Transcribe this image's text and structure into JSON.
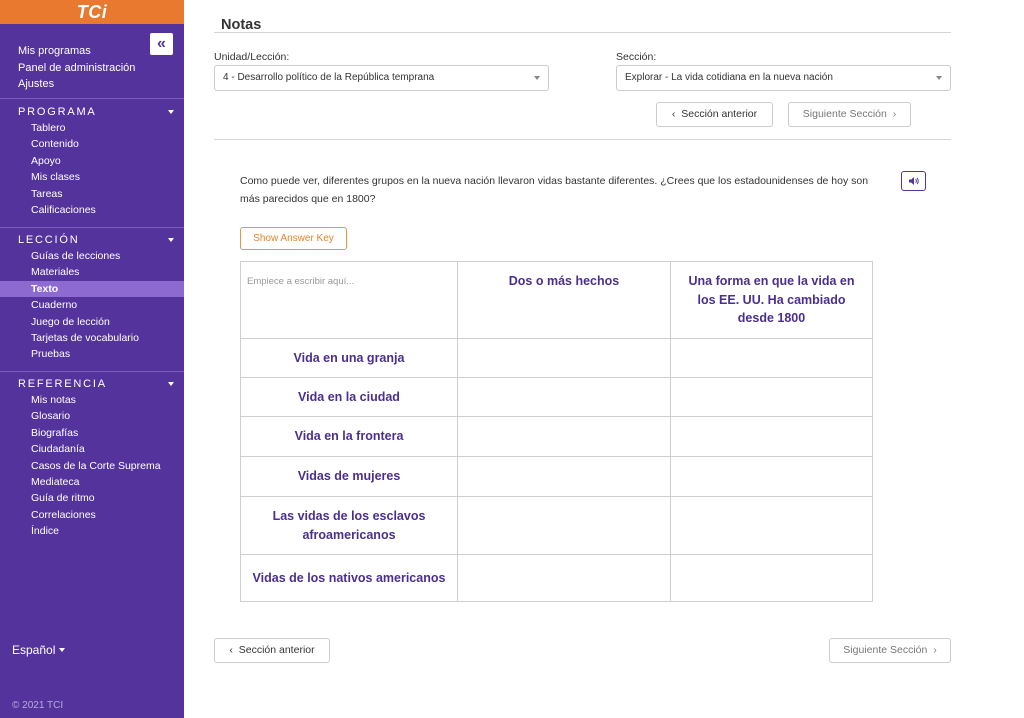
{
  "sidebar": {
    "logo": "TCi",
    "top_links": [
      "Mis programas",
      "Panel de administración",
      "Ajustes"
    ],
    "programa": {
      "title": "PROGRAMA",
      "items": [
        "Tablero",
        "Contenido",
        "Apoyo",
        "Mis clases",
        "Tareas",
        "Calificaciones"
      ]
    },
    "leccion": {
      "title": "LECCIÓN",
      "items": [
        "Guías de lecciones",
        "Materiales",
        "Texto",
        "Cuaderno",
        "Juego de lección",
        "Tarjetas de vocabulario",
        "Pruebas"
      ],
      "active": "Texto"
    },
    "referencia": {
      "title": "REFERENCIA",
      "items": [
        "Mis notas",
        "Glosario",
        "Biografías",
        "Ciudadanía",
        "Casos de la Corte Suprema",
        "Mediateca",
        "Guía de ritmo",
        "Correlaciones",
        "Índice"
      ]
    },
    "language": "Español",
    "copyright": "© 2021 TCI",
    "colors": {
      "background": "#54349c",
      "logo_bar": "#e8792e",
      "active_item": "#8c6ad0"
    }
  },
  "main": {
    "title": "Notas",
    "unit_label": "Unidad/Lección:",
    "unit_value": "4 - Desarrollo político de la República temprana",
    "section_label": "Sección:",
    "section_value": "Explorar - La vida cotidiana en la nueva nación",
    "prev_section": "Sección anterior",
    "next_section": "Siguiente Sección",
    "prompt": "Como puede ver, diferentes grupos en la nueva nación llevaron vidas bastante diferentes. ¿Crees que los estadounidenses de hoy son más parecidos que en 1800?",
    "answer_key_button": "Show Answer Key",
    "table": {
      "placeholder": "Empiece a escribir aquí...",
      "columns": [
        "Dos o más hechos",
        "Una forma en que la vida en los EE. UU. Ha cambiado desde 1800"
      ],
      "rows": [
        "Vida en una granja",
        "Vida en la ciudad",
        "Vida en la frontera",
        "Vidas de mujeres",
        "Las vidas de los esclavos afroamericanos",
        "Vidas de los nativos americanos"
      ]
    }
  },
  "icons": {
    "collapse": "double-chevron-left-icon",
    "audio": "speaker-icon",
    "chevron_left": "chevron-left-icon",
    "chevron_right": "chevron-right-icon"
  },
  "colors": {
    "accent_purple": "#4b2f8f",
    "answer_key_orange": "#e5852b"
  }
}
